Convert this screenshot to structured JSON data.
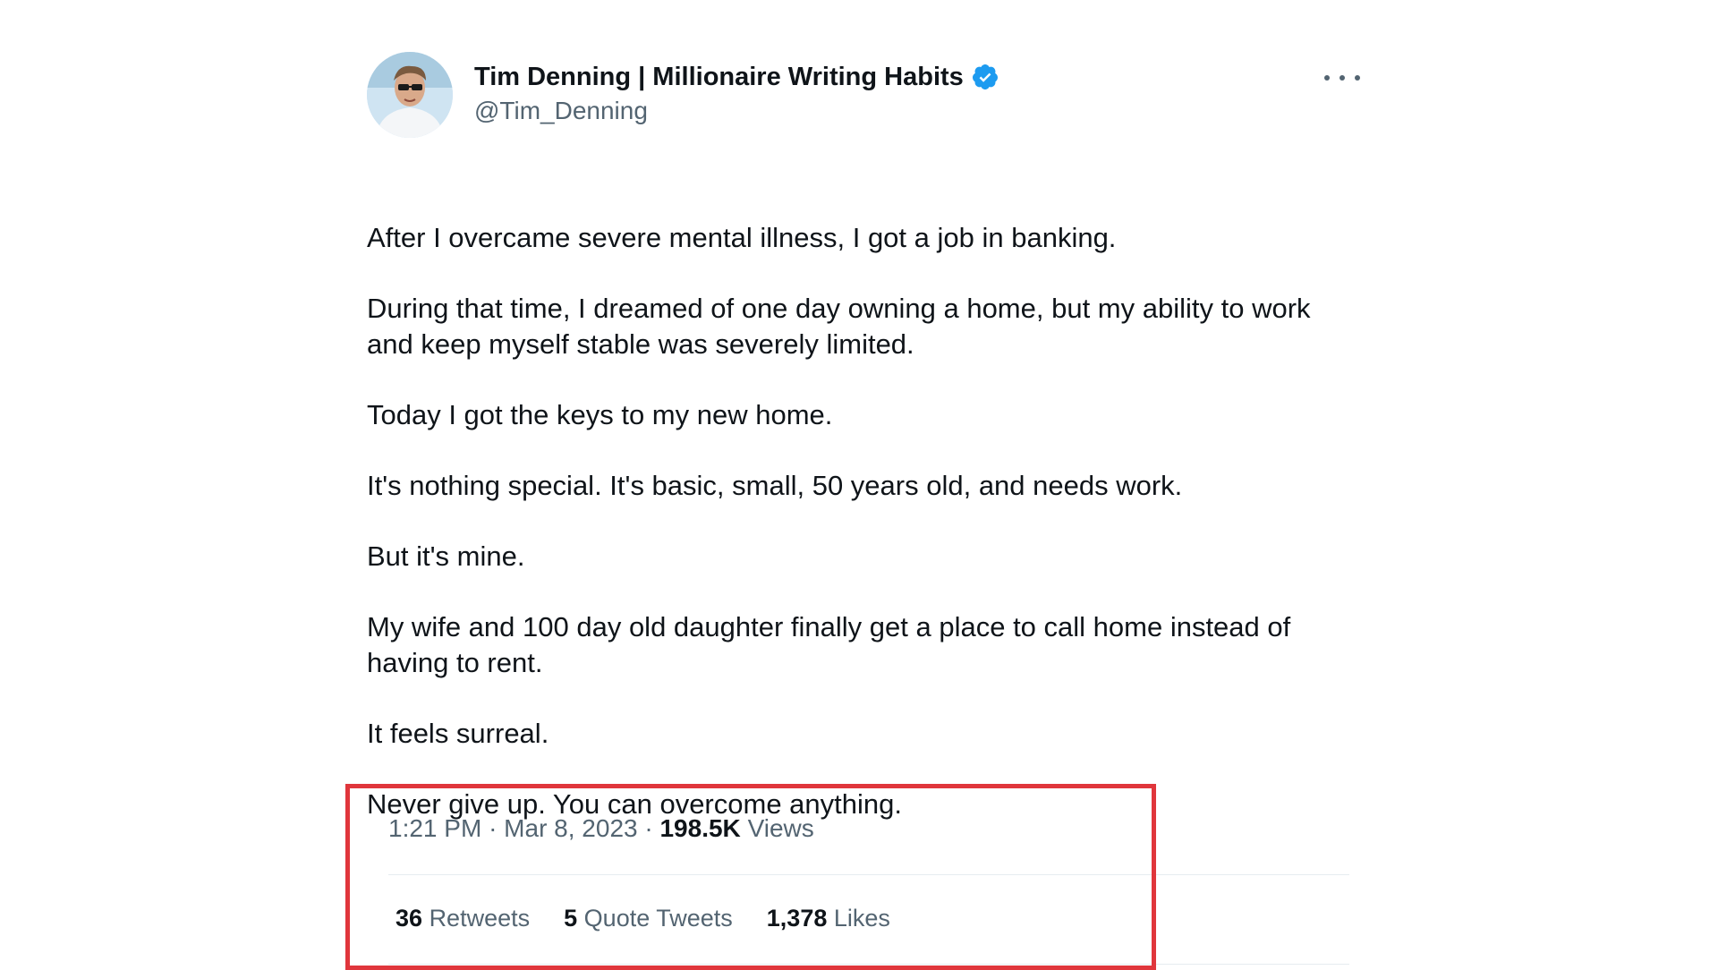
{
  "tweet": {
    "author": {
      "display_name": "Tim Denning | Millionaire Writing Habits",
      "handle": "@Tim_Denning",
      "verified": true,
      "verified_color": "#1d9bf0"
    },
    "paragraphs": [
      "After I overcame severe mental illness, I got a job in banking.",
      "During that time, I dreamed of one day owning a home, but my ability to work and keep myself stable was severely limited.",
      "Today I got the keys to my new home.",
      "It's nothing special. It's basic, small, 50 years old, and needs work.",
      "But it's mine.",
      "My wife and 100 day old daughter finally get a place to call home instead of having to rent.",
      "It feels surreal.",
      "Never give up. You can overcome anything."
    ],
    "meta": {
      "time": "1:21 PM",
      "separator": "·",
      "date": "Mar 8, 2023",
      "views_count": "198.5K",
      "views_label": "Views"
    },
    "stats": {
      "retweets_count": "36",
      "retweets_label": "Retweets",
      "quotes_count": "5",
      "quotes_label": "Quote Tweets",
      "likes_count": "1,378",
      "likes_label": "Likes"
    }
  },
  "colors": {
    "text_primary": "#0f1419",
    "text_secondary": "#536471",
    "highlight_border": "#e0363c",
    "divider": "#e6ecf0"
  },
  "icons": {
    "more": "more-horizontal-icon",
    "verified": "verified-badge-icon"
  }
}
